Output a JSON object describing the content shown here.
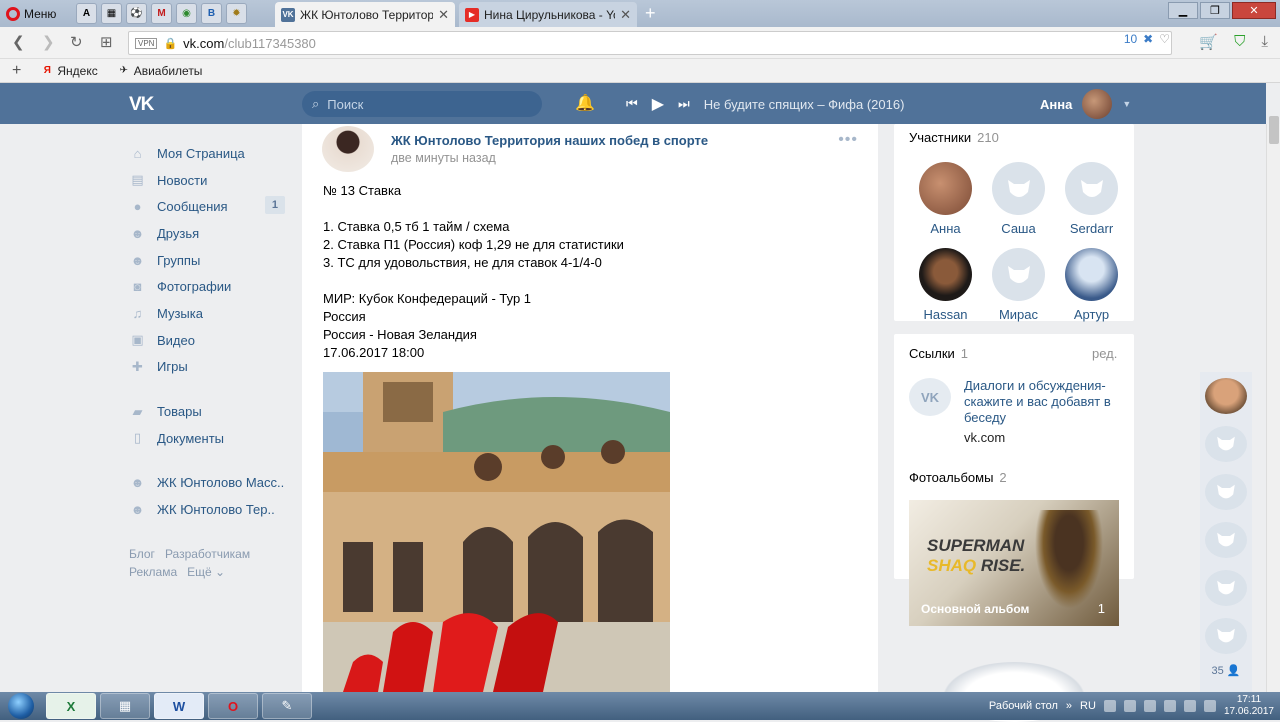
{
  "browser": {
    "menu_label": "Меню",
    "speed_tabs": [
      "A",
      "▦",
      "⚽",
      "M",
      "◉",
      "B",
      "✹"
    ],
    "tabs": [
      {
        "title": "ЖК Юнтолово Территор",
        "active": true
      },
      {
        "title": "Нина Цирульникова - You",
        "active": false
      }
    ],
    "new_tab": "+",
    "url_vpn": "VPN",
    "url_host": "vk.com",
    "url_path": "/club117345380",
    "adblock_count": "10",
    "bookmarks": [
      "Яндекс",
      "Авиабилеты"
    ]
  },
  "header": {
    "logo": "VK",
    "search_placeholder": "Поиск",
    "track": "Не будите спящих – Фифа (2016)",
    "user_name": "Анна"
  },
  "left_menu": {
    "items": [
      {
        "label": "Моя Страница",
        "icon": "⌂"
      },
      {
        "label": "Новости",
        "icon": "▤"
      },
      {
        "label": "Сообщения",
        "icon": "●",
        "badge": "1"
      },
      {
        "label": "Друзья",
        "icon": "☻"
      },
      {
        "label": "Группы",
        "icon": "☻"
      },
      {
        "label": "Фотографии",
        "icon": "◙"
      },
      {
        "label": "Музыка",
        "icon": "♫"
      },
      {
        "label": "Видео",
        "icon": "▣"
      },
      {
        "label": "Игры",
        "icon": "✚"
      }
    ],
    "items2": [
      {
        "label": "Товары",
        "icon": "▰"
      },
      {
        "label": "Документы",
        "icon": "▯"
      }
    ],
    "groups": [
      {
        "label": "ЖК Юнтолово Масс..",
        "icon": "☻"
      },
      {
        "label": "ЖК Юнтолово Тер..",
        "icon": "☻"
      }
    ],
    "footer": [
      "Блог",
      "Разработчикам",
      "Реклама",
      "Ещё ⌄"
    ]
  },
  "post": {
    "author": "ЖК Юнтолово Территория наших побед в спорте",
    "time": "две минуты назад",
    "text": "№ 13 Ставка\n\n1. Ставка 0,5 тб 1 тайм / схема\n2. Ставка П1 (Россия) коф 1,29 не для статистики\n3. ТС для удовольствия, не для ставок 4-1/4-0\n\nМИР: Кубок Конфедераций - Тур 1\nРоссия\nРоссия - Новая Зеландия\n17.06.2017 18:00"
  },
  "members": {
    "title": "Участники",
    "count": "210",
    "list": [
      "Анна",
      "Саша",
      "Serdarr",
      "Hassan",
      "Мирас",
      "Артур"
    ]
  },
  "links": {
    "title": "Ссылки",
    "count": "1",
    "edit": "ред.",
    "item_title": "Диалоги и обсуждения-скажите и вас добавят в беседу",
    "item_host": "vk.com"
  },
  "albums": {
    "title": "Фотоальбомы",
    "count": "2",
    "cover_text_1": "SUPERMAN",
    "cover_text_2": "SHAQ",
    "cover_text_3": "RISE.",
    "album_name": "Основной альбом",
    "album_count": "1"
  },
  "chat": {
    "online_count": "35"
  },
  "taskbar": {
    "desktop_label": "Рабочий стол",
    "lang": "RU",
    "time": "17:11",
    "date": "17.06.2017"
  },
  "colors": {
    "vk_blue": "#507299",
    "link": "#2a5885"
  }
}
